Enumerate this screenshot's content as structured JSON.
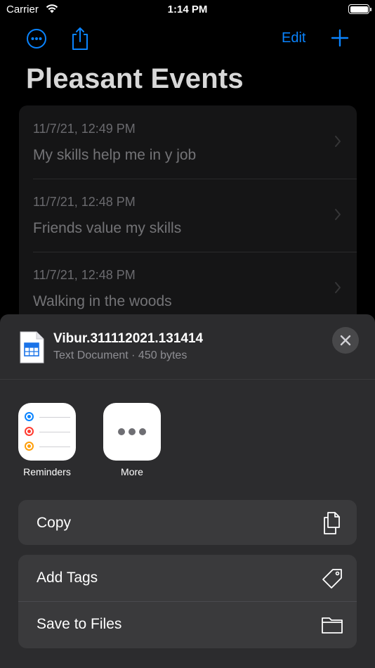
{
  "status_bar": {
    "carrier": "Carrier",
    "time": "1:14 PM"
  },
  "nav": {
    "edit_label": "Edit",
    "accent_color": "#0a84ff"
  },
  "page": {
    "title": "Pleasant Events"
  },
  "events": [
    {
      "date": "11/7/21, 12:49 PM",
      "text": "My skills help me in y job"
    },
    {
      "date": "11/7/21, 12:48 PM",
      "text": "Friends value my skills"
    },
    {
      "date": "11/7/21, 12:48 PM",
      "text": "Walking in the woods"
    }
  ],
  "share_sheet": {
    "file_name": "Vibur.311112021.131414",
    "file_meta": "Text Document · 450 bytes",
    "apps": [
      {
        "label": "Reminders",
        "icon": "reminders-icon"
      },
      {
        "label": "More",
        "icon": "ellipsis-icon"
      }
    ],
    "actions": {
      "copy": {
        "label": "Copy",
        "icon": "copy-icon"
      },
      "add_tags": {
        "label": "Add Tags",
        "icon": "tag-icon"
      },
      "save_to_files": {
        "label": "Save to Files",
        "icon": "folder-icon"
      }
    },
    "reminder_dot_colors": [
      "#0a84ff",
      "#ff3b30",
      "#ff9f0a"
    ]
  }
}
